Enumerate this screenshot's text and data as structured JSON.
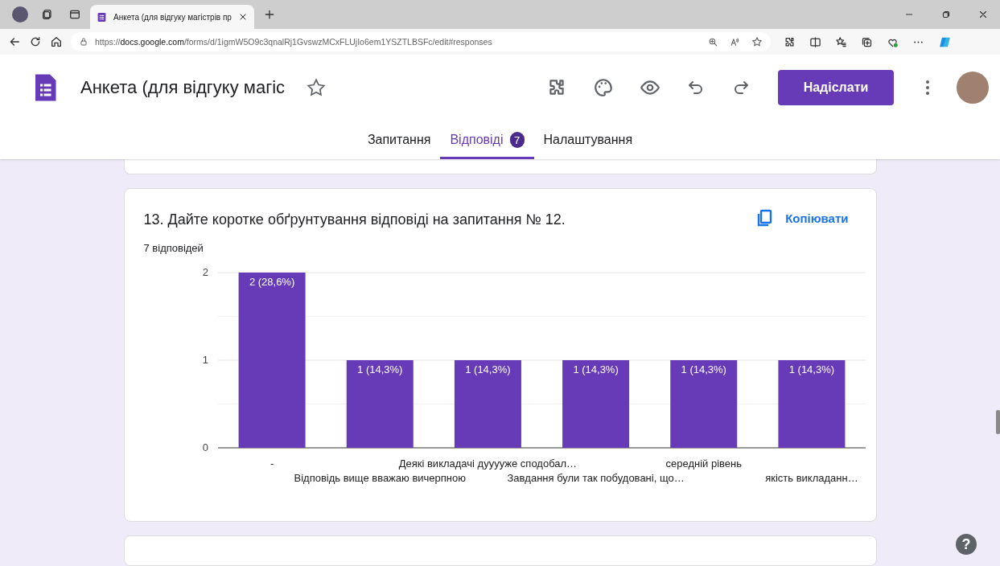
{
  "browser": {
    "tab_title": "Анкета (для відгуку магістрів пр",
    "url_prefix": "https://",
    "url_host": "docs.google.com",
    "url_path": "/forms/d/1igmW5O9c3qnalRj1GvswzMCxFLUjIo6em1YSZTLBSFc/edit#responses"
  },
  "form": {
    "title": "Анкета (для відгуку магіс",
    "send_button": "Надіслати"
  },
  "tabs": [
    {
      "label": "Запитання",
      "selected": false
    },
    {
      "label": "Відповіді",
      "selected": true,
      "badge": "7"
    },
    {
      "label": "Налаштування",
      "selected": false
    }
  ],
  "question": {
    "title": "13. Дайте коротке обґрунтування відповіді на запитання № 12.",
    "copy_button": "Копіювати",
    "response_count": "7 відповідей",
    "chart_data": {
      "type": "bar",
      "categories": [
        "-",
        "Відповідь вище вважаю вичерпною",
        "Деякі викладачі дууууже сподобал…",
        "Завдання були так побудовані, що…",
        "середній рівень",
        "якість викладанн…"
      ],
      "series": [
        {
          "color": "#673ab7",
          "values": [
            2,
            1,
            1,
            1,
            1,
            1
          ]
        }
      ],
      "ylim": [
        0,
        2
      ],
      "yticks": [
        0,
        1,
        2
      ],
      "ref_lines": [
        {
          "axis": "y",
          "value": 0.5
        },
        {
          "axis": "y",
          "value": 1.5
        }
      ],
      "value_labels": [
        "2 (28,6%)",
        "1 (14,3%)",
        "1 (14,3%)",
        "1 (14,3%)",
        "1 (14,3%)",
        "1 (14,3%)"
      ]
    }
  },
  "help_button": "?"
}
